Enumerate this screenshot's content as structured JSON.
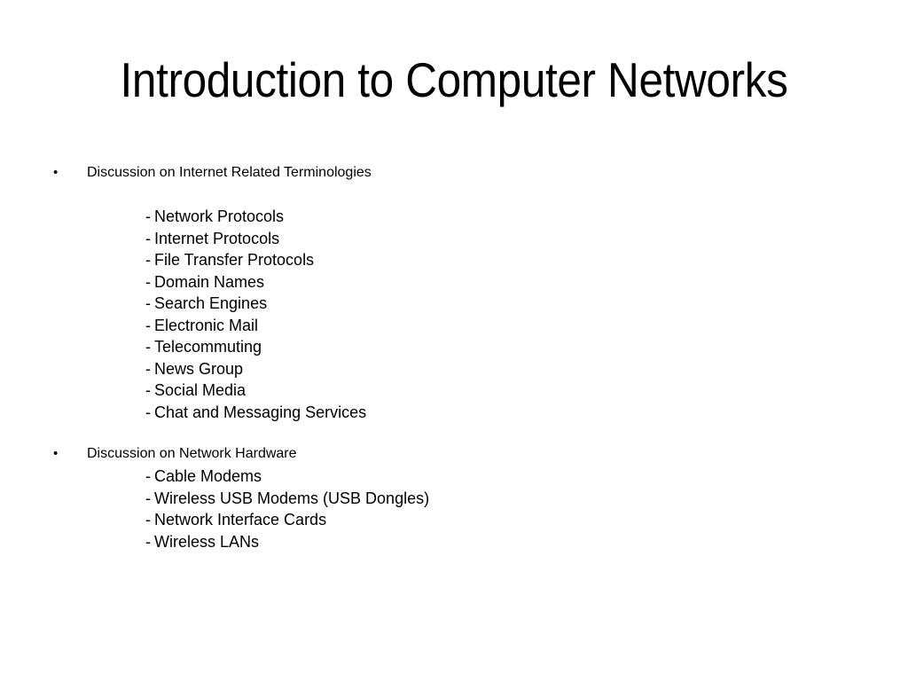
{
  "slide": {
    "title": "Introduction to Computer Networks",
    "background_color": "#ffffff",
    "text_color": "#000000",
    "bullet_glyph": "•",
    "dash_glyph": "-",
    "sections": [
      {
        "bullet": "Discussion on Internet Related Terminologies",
        "items": [
          "Network Protocols",
          "Internet Protocols",
          "File Transfer Protocols",
          "Domain Names",
          "Search Engines",
          "Electronic Mail",
          "Telecommuting",
          "News Group",
          "Social Media",
          "Chat and Messaging Services"
        ]
      },
      {
        "bullet": "Discussion on Network Hardware",
        "items": [
          "Cable Modems",
          "Wireless USB Modems (USB Dongles)",
          "Network Interface Cards",
          "Wireless LANs"
        ]
      }
    ]
  }
}
